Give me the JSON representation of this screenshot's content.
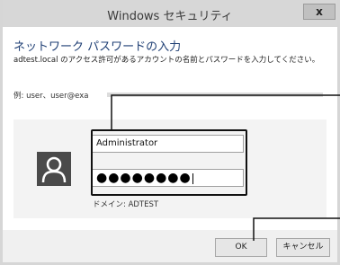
{
  "window": {
    "title": "Windows セキュリティ",
    "close_label": "x"
  },
  "dialog": {
    "heading": "ネットワーク パスワードの入力",
    "description": "adtest.local のアクセス許可があるアカウントの名前とパスワードを入力してください。",
    "example": "例: user、user@exa"
  },
  "credentials": {
    "username": "Administrator",
    "password_mask": "●●●●●●●●",
    "domain": "ドメイン: ADTEST"
  },
  "buttons": {
    "ok": "OK",
    "cancel": "キャンセル"
  }
}
